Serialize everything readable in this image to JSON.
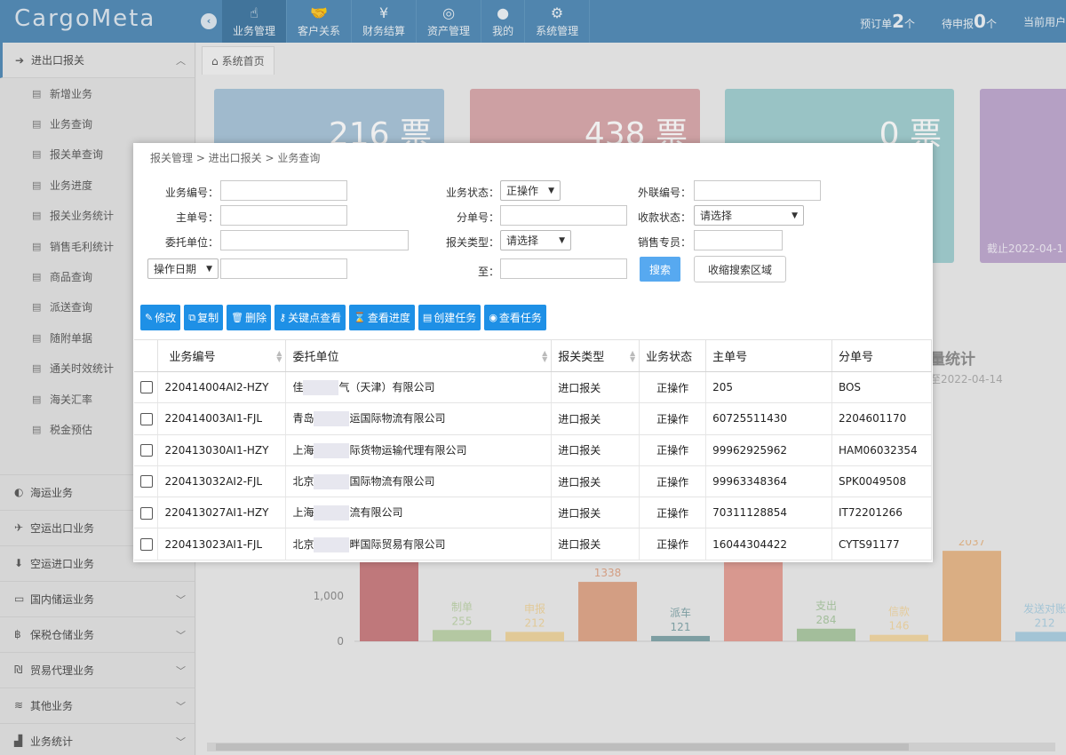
{
  "app": {
    "logo": "CargoMeta"
  },
  "nav": [
    {
      "label": "业务管理",
      "icon": "hand-pointer-icon",
      "glyph": "☝"
    },
    {
      "label": "客户关系",
      "icon": "handshake-icon",
      "glyph": "🤝"
    },
    {
      "label": "财务结算",
      "icon": "yen-icon",
      "glyph": "¥"
    },
    {
      "label": "资产管理",
      "icon": "basketball-icon",
      "glyph": "◎"
    },
    {
      "label": "我的",
      "icon": "user-icon",
      "glyph": "●"
    },
    {
      "label": "系统管理",
      "icon": "gear-icon",
      "glyph": "⚙"
    }
  ],
  "header_stats": {
    "pre_order_label": "预订单",
    "pre_order_count": "2",
    "pre_order_unit": "个",
    "pending_label": "待申报",
    "pending_count": "0",
    "pending_unit": "个",
    "current_user_label": "当前用户"
  },
  "sidebar": {
    "main_group": "进出口报关",
    "sub_items": [
      "新增业务",
      "业务查询",
      "报关单查询",
      "业务进度",
      "报关业务统计",
      "销售毛利统计",
      "商品查询",
      "派送查询",
      "随附单据",
      "通关时效统计",
      "海关汇率",
      "税金预估"
    ],
    "groups": [
      "海运业务",
      "空运出口业务",
      "空运进口业务",
      "国内储运业务",
      "保税仓储业务",
      "贸易代理业务",
      "其他业务",
      "业务统计"
    ]
  },
  "tab": {
    "label": "系统首页"
  },
  "cards": [
    {
      "value": "216 票"
    },
    {
      "value": "438 票"
    },
    {
      "value": "0 票"
    },
    {
      "date": "截止2022-04-1"
    }
  ],
  "bg_stat": {
    "title": "量统计",
    "sub": "至2022-04-14"
  },
  "chart_data": {
    "type": "bar",
    "ytick_labels": [
      "1,000",
      "0"
    ],
    "values": [
      null,
      255,
      212,
      1338,
      121,
      null,
      284,
      146,
      2037,
      212
    ],
    "labels": [
      "",
      "制单",
      "申报",
      "",
      "派车",
      "",
      "支出",
      "信款",
      "交单",
      "发送对账"
    ],
    "value_labels": [
      "",
      "255",
      "212",
      "1338",
      "121",
      "",
      "284",
      "146",
      "2037",
      "212"
    ],
    "colors": [
      "#c9787b",
      "#bcd3a8",
      "#f0d49b",
      "#e0a384",
      "#7ea3a8",
      "#e59d92",
      "#a9c8a0",
      "#f3d7a0",
      "#e7b684",
      "#a9cfe2"
    ]
  },
  "dialog": {
    "breadcrumb": "报关管理 > 进出口报关 > 业务查询",
    "form": {
      "biz_no_label": "业务编号：",
      "biz_status_label": "业务状态：",
      "biz_status_value": "正操作",
      "ext_no_label": "外联编号：",
      "master_no_label": "主单号：",
      "sub_no_label": "分单号：",
      "collect_status_label": "收款状态：",
      "collect_status_value": "请选择",
      "client_label": "委托单位：",
      "customs_type_label": "报关类型：",
      "customs_type_value": "请选择",
      "sales_label": "销售专员：",
      "date_type_value": "操作日期",
      "to_label": "至：",
      "search_btn": "搜索",
      "collapse_btn": "收缩搜索区域"
    },
    "toolbar": [
      {
        "label": "修改",
        "icon": "pencil-icon",
        "glyph": "✎"
      },
      {
        "label": "复制",
        "icon": "copy-icon",
        "glyph": "⧉"
      },
      {
        "label": "删除",
        "icon": "trash-icon",
        "glyph": "🗑"
      },
      {
        "label": "关键点查看",
        "icon": "key-icon",
        "glyph": "⚷"
      },
      {
        "label": "查看进度",
        "icon": "hourglass-icon",
        "glyph": "⌛"
      },
      {
        "label": "创建任务",
        "icon": "card-icon",
        "glyph": "▤"
      },
      {
        "label": "查看任务",
        "icon": "eye-icon",
        "glyph": "◉"
      }
    ],
    "table": {
      "headers": [
        "业务编号",
        "委托单位",
        "报关类型",
        "业务状态",
        "主单号",
        "分单号"
      ],
      "rows": [
        {
          "biz_no": "220414004AI2-HZY",
          "client_pre": "佳",
          "client_post": "气（天津）有限公司",
          "type": "进口报关",
          "status": "正操作",
          "master": "205",
          "sub": "BOS"
        },
        {
          "biz_no": "220414003AI1-FJL",
          "client_pre": "青岛",
          "client_post": "运国际物流有限公司",
          "type": "进口报关",
          "status": "正操作",
          "master": "60725511430",
          "sub": "2204601170"
        },
        {
          "biz_no": "220413030AI1-HZY",
          "client_pre": "上海",
          "client_post": "际货物运输代理有限公司",
          "type": "进口报关",
          "status": "正操作",
          "master": "99962925962",
          "sub": "HAM06032354"
        },
        {
          "biz_no": "220413032AI2-FJL",
          "client_pre": "北京",
          "client_post": "国际物流有限公司",
          "type": "进口报关",
          "status": "正操作",
          "master": "99963348364",
          "sub": "SPK0049508"
        },
        {
          "biz_no": "220413027AI1-HZY",
          "client_pre": "上海",
          "client_post": "流有限公司",
          "type": "进口报关",
          "status": "正操作",
          "master": "70311128854",
          "sub": "IT72201266"
        },
        {
          "biz_no": "220413023AI1-FJL",
          "client_pre": "北京",
          "client_post": "畔国际贸易有限公司",
          "type": "进口报关",
          "status": "正操作",
          "master": "16044304422",
          "sub": "CYTS91177"
        }
      ]
    }
  }
}
